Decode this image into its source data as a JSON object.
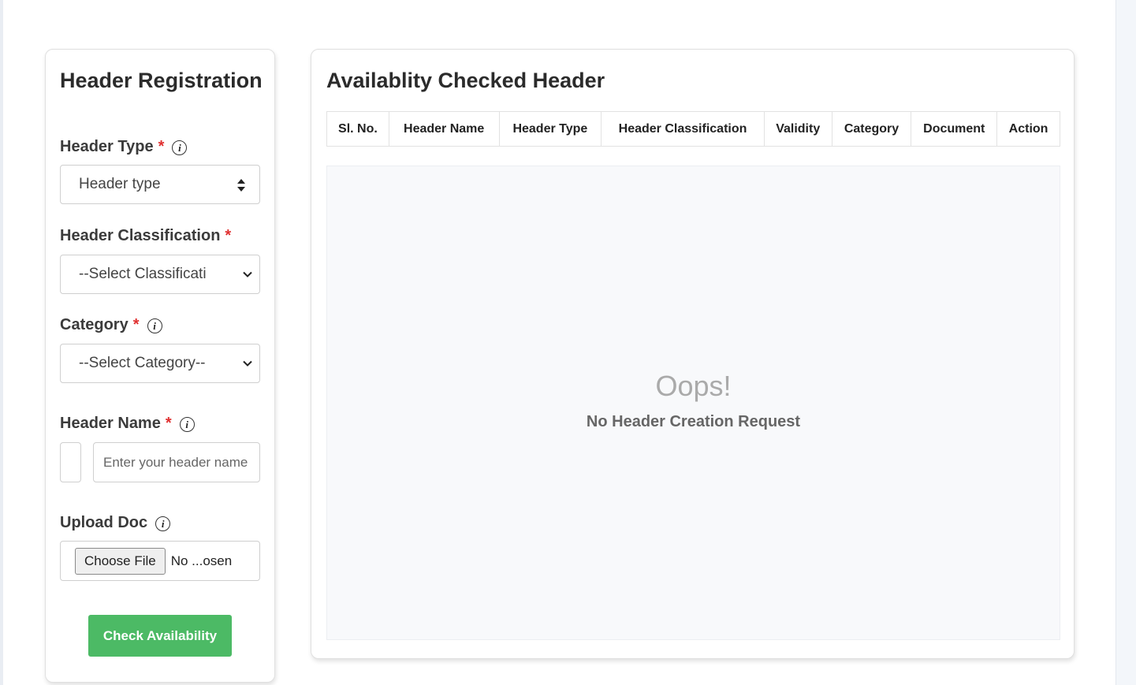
{
  "registration": {
    "title": "Header Registration",
    "header_type": {
      "label": "Header Type",
      "required_mark": "*",
      "info_icon": "i",
      "selected": "Header type"
    },
    "header_classification": {
      "label": "Header Classification",
      "required_mark": "*",
      "selected": "--Select Classificati"
    },
    "category": {
      "label": "Category",
      "required_mark": "*",
      "info_icon": "i",
      "selected": "--Select Category--"
    },
    "header_name": {
      "label": "Header Name",
      "required_mark": "*",
      "info_icon": "i",
      "placeholder": "Enter your header name"
    },
    "upload_doc": {
      "label": "Upload Doc",
      "info_icon": "i",
      "choose_file_label": "Choose File",
      "file_status": "No ...osen"
    },
    "check_button_label": "Check Availability"
  },
  "availability": {
    "title": "Availablity Checked Header",
    "columns": [
      "Sl. No.",
      "Header Name",
      "Header Type",
      "Header Classification",
      "Validity",
      "Category",
      "Document",
      "Action"
    ],
    "empty_title": "Oops!",
    "empty_message": "No Header Creation Request"
  },
  "colors": {
    "accent_green": "#4cba65",
    "required_red": "#e03030",
    "empty_bg": "#f8f9fb"
  }
}
